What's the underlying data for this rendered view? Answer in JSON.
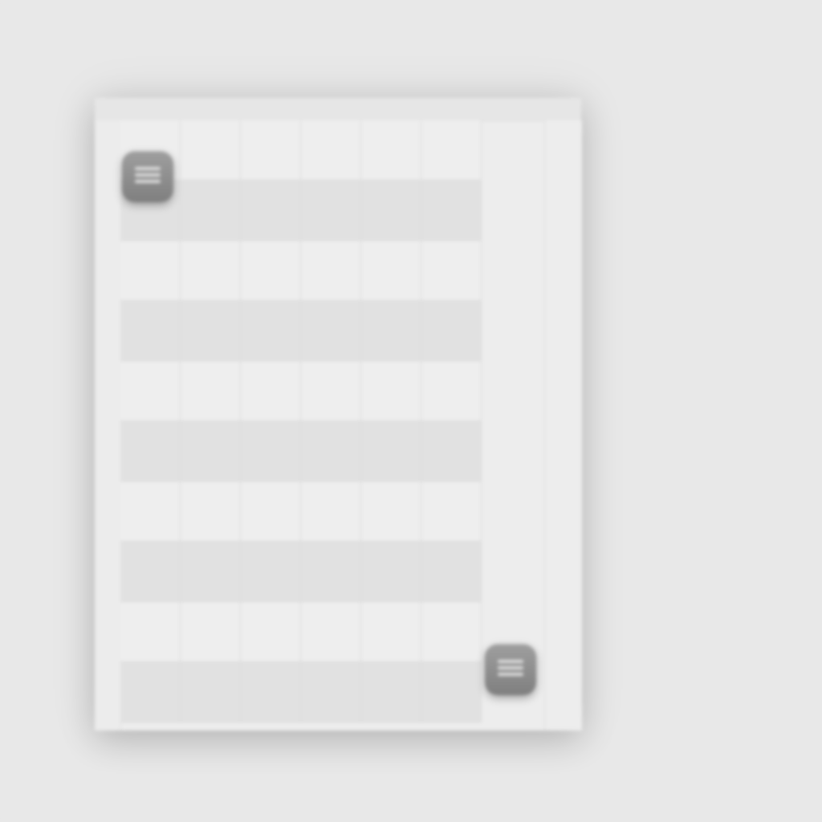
{
  "colors": {
    "background": "#e8e8e8",
    "board": "#ededed",
    "cell_light": "#eeeeee",
    "cell_dark": "#e1e1e1",
    "grid_line": "#d9d9d9",
    "handle": "#8f8f8f"
  },
  "grid": {
    "columns": 6,
    "rows": 10
  },
  "handles": [
    {
      "name": "top-left",
      "icon": "drag-lines-icon"
    },
    {
      "name": "bottom-right",
      "icon": "drag-lines-icon"
    }
  ]
}
